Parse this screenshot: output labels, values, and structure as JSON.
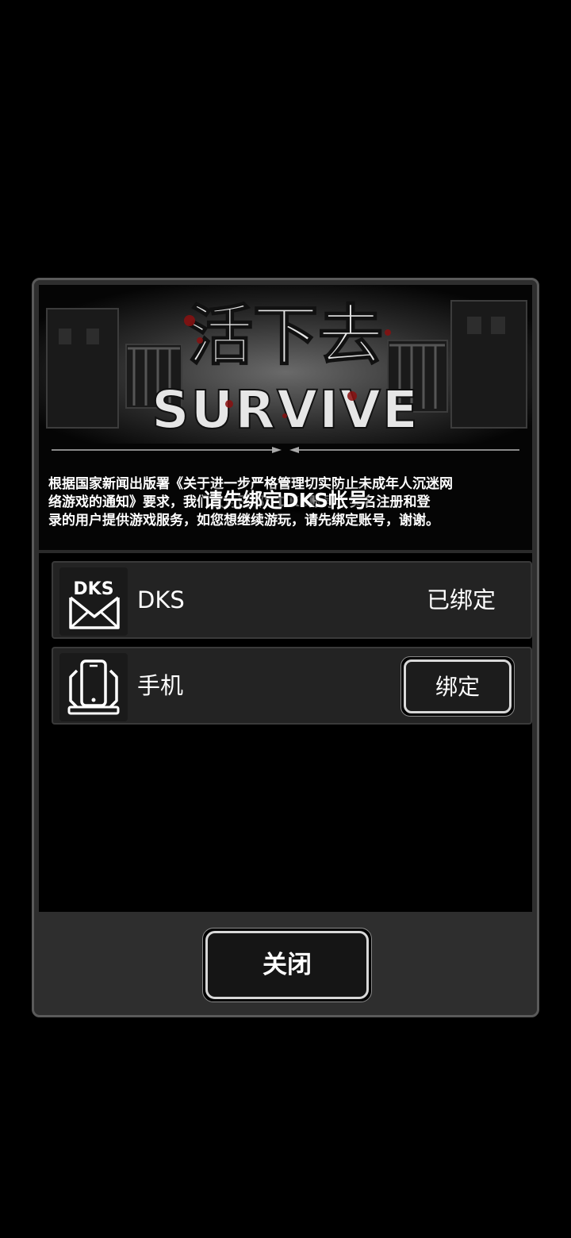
{
  "banner": {
    "logo_cn": "活下去",
    "logo_en": "SURVIVE",
    "notice_lines": [
      "根据国家新闻出版署《关于进一步严格管理切实防止未成年人沉迷网",
      "络游戏的通知》要求，我们仅对已绑定DKS账号、实名注册和登",
      "录的用户提供游戏服务，如您想继续游玩，请先绑定账号，谢谢。"
    ],
    "title": "请先绑定DKS帐号"
  },
  "accounts": [
    {
      "icon": "dks-mail-icon",
      "icon_text": "DKS",
      "label": "DKS",
      "status": "已绑定"
    },
    {
      "icon": "mobile-phone-icon",
      "label": "手机",
      "button": "绑定"
    }
  ],
  "close_button": "关闭",
  "colors": {
    "background": "#000000",
    "dialog_frame": "#5a5a5a",
    "row_bg": "#232323",
    "text": "#ffffff",
    "accent_blood": "#8a1010"
  }
}
